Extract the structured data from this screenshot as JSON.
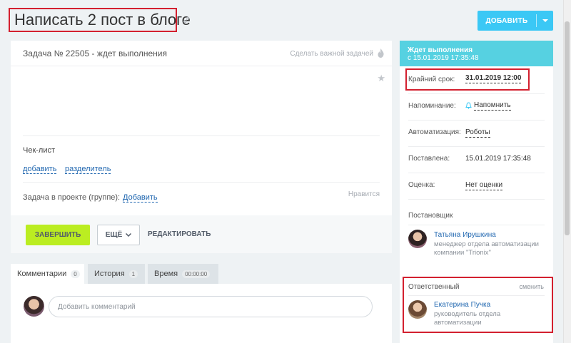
{
  "header": {
    "title": "Написать 2 пост в блоге",
    "add_label": "ДОБАВИТЬ"
  },
  "task": {
    "number_status": "Задача № 22505 - ждет выполнения",
    "make_important": "Сделать важной задачей",
    "checklist_label": "Чек-лист",
    "checklist_add": "добавить",
    "checklist_separator": "разделитель",
    "project_label": "Задача в проекте (группе):",
    "project_add": "Добавить",
    "likes": "Нравится"
  },
  "actions": {
    "complete": "ЗАВЕРШИТЬ",
    "more": "ЕЩЁ",
    "edit": "РЕДАКТИРОВАТЬ"
  },
  "tabs": [
    {
      "label": "Комментарии",
      "count": "0"
    },
    {
      "label": "История",
      "count": "1"
    },
    {
      "label": "Время",
      "count": "00:00:00"
    }
  ],
  "comments": {
    "placeholder": "Добавить комментарий"
  },
  "sidebar": {
    "status_title": "Ждет выполнения",
    "status_since": "с 15.01.2019 17:35:48",
    "deadline_label": "Крайний срок:",
    "deadline_value": "31.01.2019 12:00",
    "reminder_label": "Напоминание:",
    "reminder_value": "Напомнить",
    "automation_label": "Автоматизация:",
    "automation_value": "Роботы",
    "created_label": "Поставлена:",
    "created_value": "15.01.2019 17:35:48",
    "rating_label": "Оценка:",
    "rating_value": "Нет оценки",
    "creator_label": "Постановщик",
    "creator_name": "Татьяна Ирушкина",
    "creator_role": "менеджер отдела автоматизации компании \"Trionix\"",
    "responsible_label": "Ответственный",
    "responsible_change": "сменить",
    "responsible_name": "Екатерина Пучка",
    "responsible_role": "руководитель отдела автоматизации"
  },
  "colors": {
    "accent": "#3bc8f5",
    "status": "#56d1e1",
    "complete": "#bbed21",
    "highlight": "#d3202f",
    "link": "#2067b0"
  }
}
